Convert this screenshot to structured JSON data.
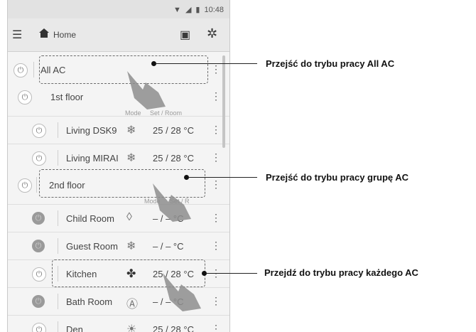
{
  "status_bar": {
    "time": "10:48"
  },
  "app_bar": {
    "title": "Home"
  },
  "all_ac": {
    "label": "All AC"
  },
  "first_floor": {
    "label": "1st floor"
  },
  "column_headers": {
    "mode": "Mode",
    "set_room": "Set / Room"
  },
  "column_headers_2": {
    "mode": "Mode",
    "set_room": "Set / R"
  },
  "second_floor": {
    "label": "2nd floor"
  },
  "rooms": [
    {
      "name": "Living DSK9",
      "mode": "snowflake-icon",
      "temp": "25 / 28 °C",
      "power": "off"
    },
    {
      "name": "Living MIRAI",
      "mode": "snowflake-icon",
      "temp": "25 / 28 °C",
      "power": "off"
    },
    {
      "name": "Child Room",
      "mode": "drop-icon",
      "temp": "– / –  °C",
      "power": "on"
    },
    {
      "name": "Guest Room",
      "mode": "snowflake-icon",
      "temp": "– / –  °C",
      "power": "on"
    },
    {
      "name": "Kitchen",
      "mode": "fan-icon",
      "temp": "25 / 28 °C",
      "power": "off"
    },
    {
      "name": "Bath Room",
      "mode": "auto-icon",
      "temp": "– / –  °C",
      "power": "on"
    },
    {
      "name": "Den",
      "mode": "sun-icon",
      "temp": "25 / 28 °C",
      "power": "off"
    }
  ],
  "callouts": [
    {
      "text": "Przejść do trybu pracy All AC"
    },
    {
      "text": "Przejść do trybu pracy grupę AC"
    },
    {
      "text": "Przejdź do trybu pracy każdego AC"
    }
  ]
}
